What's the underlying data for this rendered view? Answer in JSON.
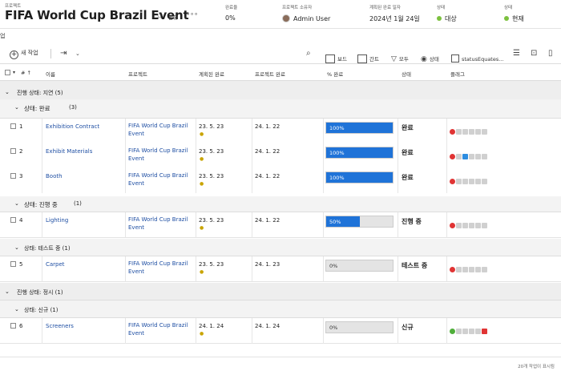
{
  "header": {
    "kind_label": "프로젝트",
    "title": "FIFA World Cup Brazil Event",
    "share_label": "공유",
    "more_label": "∘∘∘",
    "completion_label": "완료율",
    "completion_value": "0%",
    "owner_label": "프로젝트 소유자",
    "owner_value": "Admin User",
    "planned_label": "계획된 완료 일자",
    "planned_value": "2024년 1월 24일",
    "condition_label": "상태",
    "condition_value": "대상",
    "status_label": "상태",
    "status_value": "현재"
  },
  "subnav": {
    "label": "업"
  },
  "toolbar": {
    "new_task": "새 작업",
    "board": "보드",
    "gantt": "간트",
    "filter": "모두",
    "view": "상태",
    "grouping": "statusEquates..."
  },
  "columns": {
    "num": "#",
    "name": "이름",
    "project": "프로젝트",
    "planned": "계획된 완료",
    "projcomp": "프로젝트 완료",
    "pct": "% 완료",
    "status": "상태",
    "flags": "플래그"
  },
  "groups": {
    "late": "진행 상태: 지연 (5)",
    "done": "상태: 완료",
    "done_count": "(3)",
    "inprog": "상태: 진행 중",
    "inprog_count": "(1)",
    "testing": "상태: 테스트 중 (1)",
    "ontime": "진행 상태: 정시 (1)",
    "new": "상태: 신규 (1)"
  },
  "rows": [
    {
      "num": "1",
      "name": "Exhibition Contract",
      "project": "FIFA World Cup Brazil Event",
      "planned": "23. 5. 23",
      "projcomp": "24. 1. 22",
      "pct_label": "100%",
      "pct": 100,
      "status": "완료"
    },
    {
      "num": "2",
      "name": "Exhibit Materials",
      "project": "FIFA World Cup Brazil Event",
      "planned": "23. 5. 23",
      "projcomp": "24. 1. 22",
      "pct_label": "100%",
      "pct": 100,
      "status": "완료"
    },
    {
      "num": "3",
      "name": "Booth",
      "project": "FIFA World Cup Brazil Event",
      "planned": "23. 5. 23",
      "projcomp": "24. 1. 22",
      "pct_label": "100%",
      "pct": 100,
      "status": "완료"
    },
    {
      "num": "4",
      "name": "Lighting",
      "project": "FIFA World Cup Brazil Event",
      "planned": "23. 5. 23",
      "projcomp": "24. 1. 22",
      "pct_label": "50%",
      "pct": 50,
      "status": "진행 중"
    },
    {
      "num": "5",
      "name": "Carpet",
      "project": "FIFA World Cup Brazil Event",
      "planned": "23. 5. 23",
      "projcomp": "24. 1. 23",
      "pct_label": "0%",
      "pct": 0,
      "status": "테스트 중"
    },
    {
      "num": "6",
      "name": "Screeners",
      "project": "FIFA World Cup Brazil Event",
      "planned": "24. 1. 24",
      "projcomp": "24. 1. 24",
      "pct_label": "0%",
      "pct": 0,
      "status": "신규"
    }
  ],
  "footer": {
    "count": "20개 작업이 표시됨"
  },
  "colors": {
    "accent": "#1f73d8",
    "ok": "#7cc13e",
    "late": "#e03434"
  }
}
